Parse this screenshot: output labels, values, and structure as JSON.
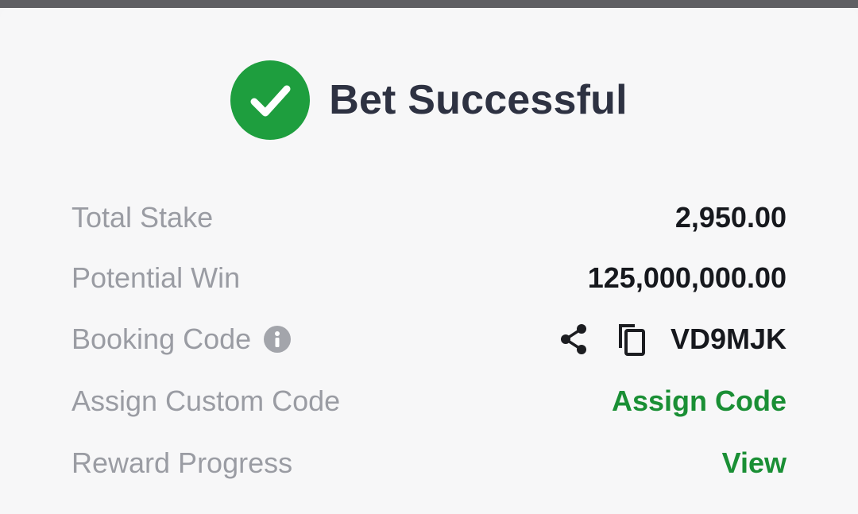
{
  "header": {
    "title": "Bet Successful",
    "status_icon": "check-circle-icon",
    "accent_color": "#1e9e3e"
  },
  "rows": {
    "total_stake": {
      "label": "Total Stake",
      "value": "2,950.00"
    },
    "potential_win": {
      "label": "Potential Win",
      "value": "125,000,000.00"
    },
    "booking_code": {
      "label": "Booking Code",
      "info_icon": "info-icon",
      "share_icon": "share-icon",
      "copy_icon": "copy-icon",
      "value": "VD9MJK"
    },
    "custom_code": {
      "label": "Assign Custom Code",
      "action": "Assign Code"
    },
    "reward_progress": {
      "label": "Reward Progress",
      "action": "View"
    }
  },
  "colors": {
    "label": "#9a9ca3",
    "value": "#16181d",
    "action": "#1a8f35",
    "title": "#2e3242"
  }
}
